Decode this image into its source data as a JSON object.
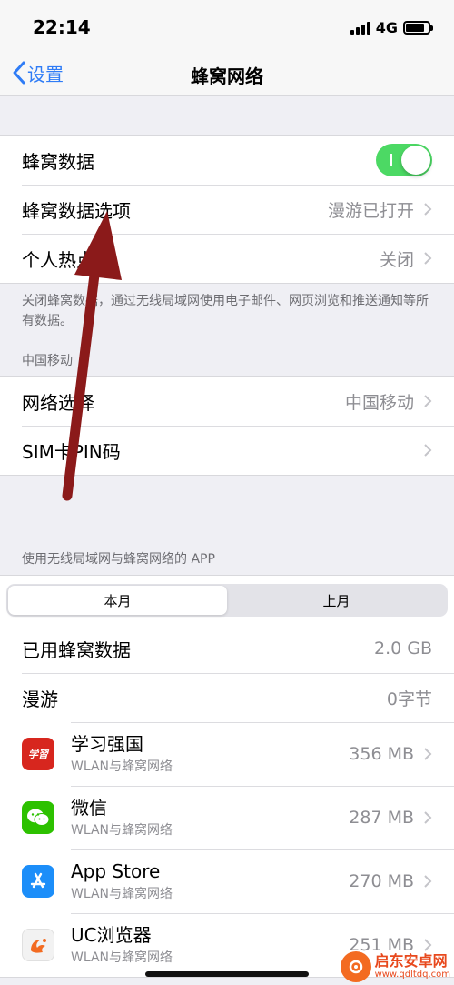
{
  "status": {
    "time": "22:14",
    "network": "4G"
  },
  "nav": {
    "back_label": "设置",
    "title": "蜂窝网络"
  },
  "cellular_group": {
    "rows": [
      {
        "label": "蜂窝数据"
      },
      {
        "label": "蜂窝数据选项",
        "value": "漫游已打开"
      },
      {
        "label": "个人热点",
        "value": "关闭"
      }
    ]
  },
  "cellular_footnote": "关闭蜂窝数据，通过无线局域网使用电子邮件、网页浏览和推送通知等所有数据。",
  "carrier_header": "中国移动",
  "carrier_group": {
    "rows": [
      {
        "label": "网络选择",
        "value": "中国移动"
      },
      {
        "label": "SIM卡PIN码"
      }
    ]
  },
  "apps_header": "使用无线局域网与蜂窝网络的 APP",
  "segments": [
    "本月",
    "上月"
  ],
  "usage_group": {
    "rows": [
      {
        "label": "已用蜂窝数据",
        "value": "2.0 GB"
      },
      {
        "label": "漫游",
        "value": "0字节"
      }
    ]
  },
  "apps": [
    {
      "name": "学习强国",
      "sub": "WLAN与蜂窝网络",
      "size": "356 MB",
      "color": "#d7261e",
      "icon": "xuexi-qiangguo-icon",
      "glyph": "学習"
    },
    {
      "name": "微信",
      "sub": "WLAN与蜂窝网络",
      "size": "287 MB",
      "color": "#2dc100",
      "icon": "wechat-icon"
    },
    {
      "name": "App Store",
      "sub": "WLAN与蜂窝网络",
      "size": "270 MB",
      "color": "#1c8ef9",
      "icon": "app-store-icon"
    },
    {
      "name": "UC浏览器",
      "sub": "WLAN与蜂窝网络",
      "size": "251 MB",
      "color": "#f2f2f2",
      "icon": "uc-browser-icon"
    }
  ],
  "watermark": {
    "title": "启东安卓网",
    "url": "www.qdltdq.com"
  },
  "colors": {
    "accent": "#2f7cf6",
    "toggle_on": "#4cd964",
    "arrow": "#8b1a1a"
  }
}
